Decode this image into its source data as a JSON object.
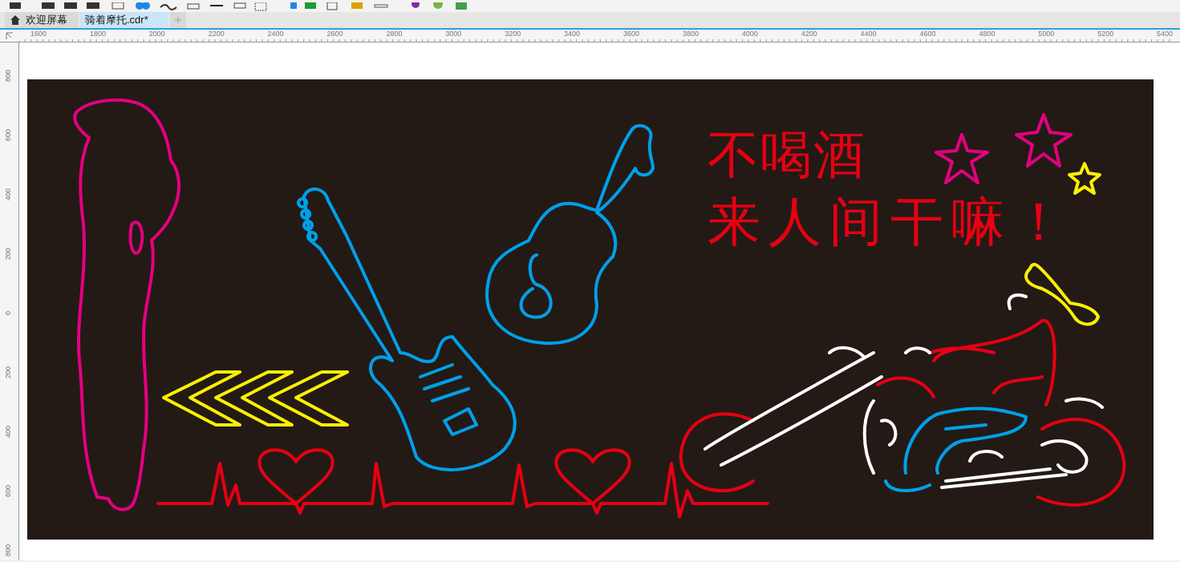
{
  "tabs": [
    {
      "label": "欢迎屏幕",
      "selected": false
    },
    {
      "label": "骑着摩托.cdr*",
      "selected": true
    }
  ],
  "new_tab": {
    "label": "+"
  },
  "ruler_horizontal": [
    "1600",
    "1800",
    "2000",
    "2200",
    "2400",
    "2600",
    "2800",
    "3000",
    "3200",
    "3400",
    "3600",
    "3800",
    "4000",
    "4200",
    "4400",
    "4600",
    "4800",
    "5000",
    "5200",
    "5400"
  ],
  "ruler_vertical": [
    "800",
    "600",
    "400",
    "200",
    "0",
    "200",
    "400",
    "600",
    "800"
  ],
  "artwork": {
    "title_lines": [
      "不喝酒",
      "来人间干嘛！"
    ]
  }
}
